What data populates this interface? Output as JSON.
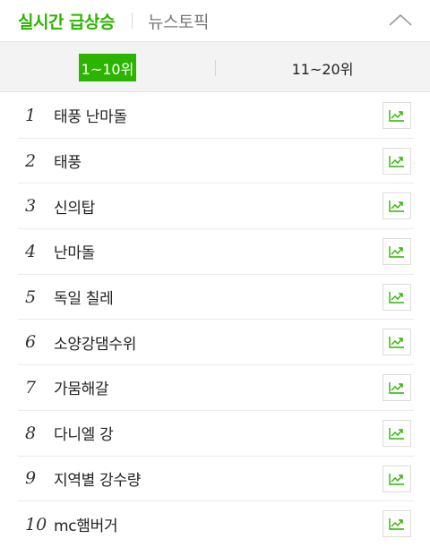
{
  "header": {
    "tab_realtime": "실시간 급상승",
    "tab_news": "뉴스토픽",
    "collapse_icon": "chevron-up-icon"
  },
  "subtabs": [
    "1~10위",
    "11~20위"
  ],
  "rankings": [
    {
      "rank": "1",
      "keyword": "태풍 난마돌"
    },
    {
      "rank": "2",
      "keyword": "태풍"
    },
    {
      "rank": "3",
      "keyword": "신의탑"
    },
    {
      "rank": "4",
      "keyword": "난마돌"
    },
    {
      "rank": "5",
      "keyword": "독일 칠레"
    },
    {
      "rank": "6",
      "keyword": "소양강댐수위"
    },
    {
      "rank": "7",
      "keyword": "가뭄해갈"
    },
    {
      "rank": "8",
      "keyword": "다니엘 강"
    },
    {
      "rank": "9",
      "keyword": "지역별 강수량"
    },
    {
      "rank": "10",
      "keyword": "mc햄버거"
    }
  ],
  "colors": {
    "accent": "#2db400",
    "text": "#222222",
    "muted": "#777777",
    "subtab_bg": "#f3f3f3"
  },
  "icons": {
    "trend": "trend-chart-icon"
  }
}
